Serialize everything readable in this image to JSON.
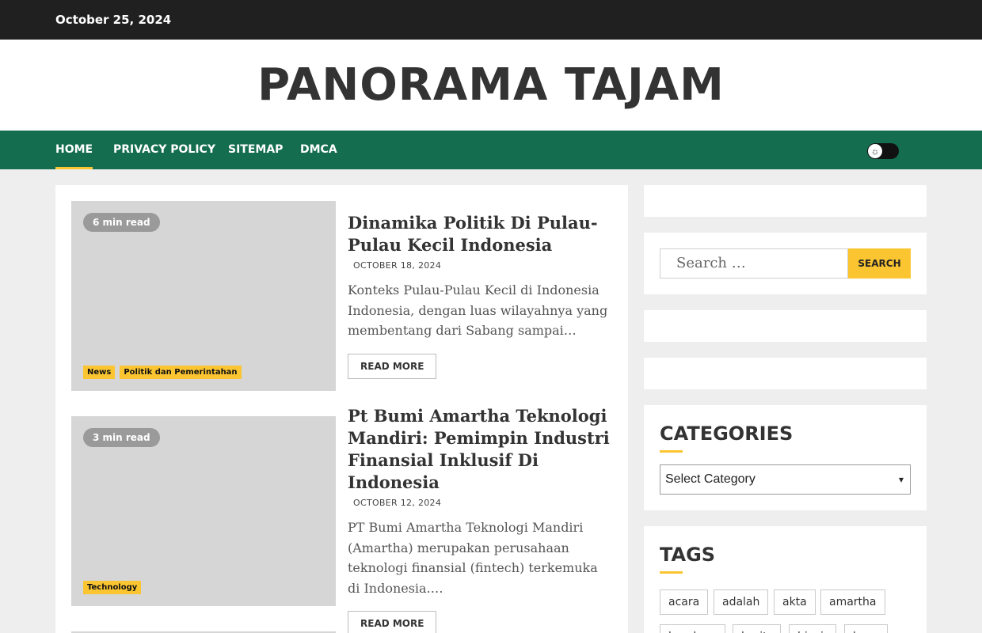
{
  "topbar": {
    "date": "October 25, 2024"
  },
  "site": {
    "title": "PANORAMA TAJAM"
  },
  "nav": {
    "items": [
      "HOME",
      "PRIVACY POLICY",
      "SITEMAP",
      "DMCA"
    ],
    "active": "HOME",
    "theme_toggle_icon": "sun-icon"
  },
  "posts": [
    {
      "read_time": "6 min read",
      "categories": [
        "News",
        "Politik dan Pemerintahan"
      ],
      "title": "Dinamika Politik Di Pulau-Pulau Kecil Indonesia",
      "date": "OCTOBER 18, 2024",
      "excerpt": "Konteks Pulau-Pulau Kecil di Indonesia Indonesia, dengan luas wilayahnya yang membentang dari Sabang sampai…",
      "read_more": "READ MORE"
    },
    {
      "read_time": "3 min read",
      "categories": [
        "Technology"
      ],
      "title": "Pt Bumi Amartha Teknologi Mandiri: Pemimpin Industri Finansial Inklusif Di Indonesia",
      "date": "OCTOBER 12, 2024",
      "excerpt": "PT Bumi Amartha Teknologi Mandiri (Amartha) merupakan perusahaan teknologi finansial (fintech) terkemuka di Indonesia.…",
      "read_more": "READ MORE"
    }
  ],
  "sidebar": {
    "search": {
      "placeholder": "Search …",
      "button": "SEARCH"
    },
    "categories": {
      "title": "CATEGORIES",
      "selected": "Select Category"
    },
    "tags": {
      "title": "TAGS",
      "items": [
        "acara",
        "adalah",
        "akta",
        "amartha",
        "bandung",
        "berita",
        "bisnis",
        "buang"
      ]
    }
  },
  "colors": {
    "nav_bg": "#146d4f",
    "accent": "#fbc531",
    "topbar_bg": "#202020"
  }
}
